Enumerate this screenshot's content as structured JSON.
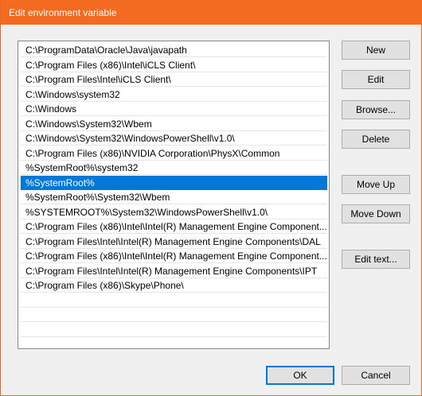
{
  "window": {
    "title": "Edit environment variable",
    "colors": {
      "title_bar": "#f26b21",
      "selection": "#0078d7"
    }
  },
  "list": {
    "items": [
      "C:\\ProgramData\\Oracle\\Java\\javapath",
      "C:\\Program Files (x86)\\Intel\\iCLS Client\\",
      "C:\\Program Files\\Intel\\iCLS Client\\",
      "C:\\Windows\\system32",
      "C:\\Windows",
      "C:\\Windows\\System32\\Wbem",
      "C:\\Windows\\System32\\WindowsPowerShell\\v1.0\\",
      "C:\\Program Files (x86)\\NVIDIA Corporation\\PhysX\\Common",
      "%SystemRoot%\\system32",
      "%SystemRoot%",
      "%SystemRoot%\\System32\\Wbem",
      "%SYSTEMROOT%\\System32\\WindowsPowerShell\\v1.0\\",
      "C:\\Program Files (x86)\\Intel\\Intel(R) Management Engine Component...",
      "C:\\Program Files\\Intel\\Intel(R) Management Engine Components\\DAL",
      "C:\\Program Files (x86)\\Intel\\Intel(R) Management Engine Component...",
      "C:\\Program Files\\Intel\\Intel(R) Management Engine Components\\IPT",
      "C:\\Program Files (x86)\\Skype\\Phone\\"
    ],
    "selected_index": 9
  },
  "buttons": {
    "new": "New",
    "edit": "Edit",
    "browse": "Browse...",
    "delete": "Delete",
    "move_up": "Move Up",
    "move_down": "Move Down",
    "edit_text": "Edit text...",
    "ok": "OK",
    "cancel": "Cancel"
  }
}
